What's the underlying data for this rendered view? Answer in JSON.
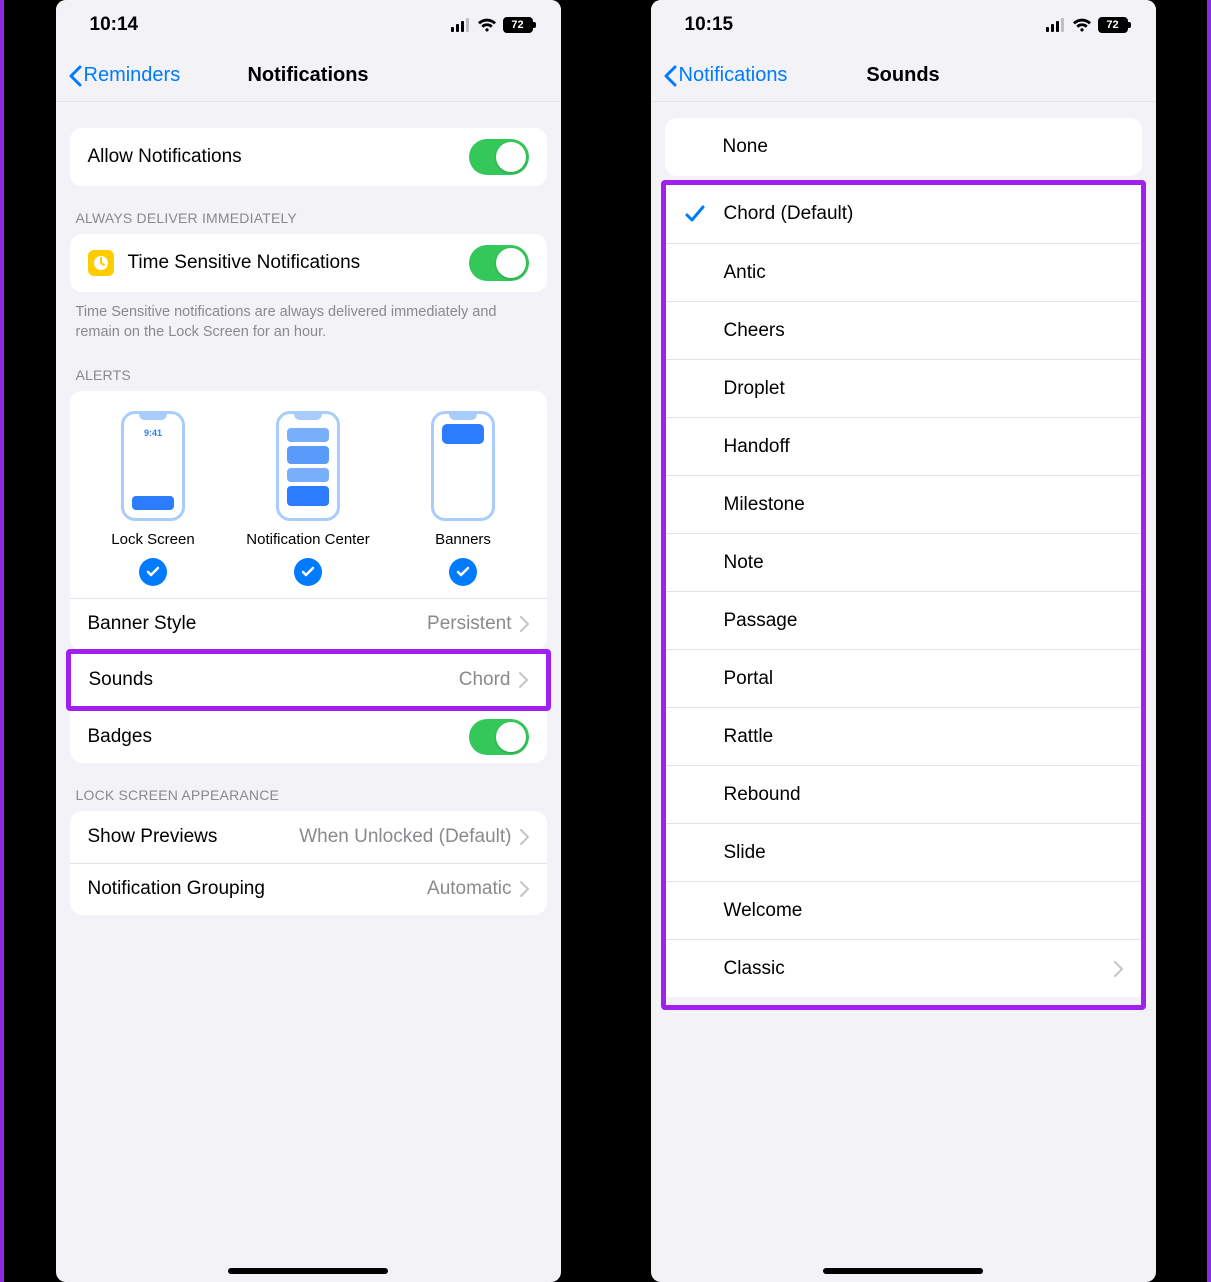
{
  "left": {
    "status": {
      "time": "10:14",
      "battery": "72"
    },
    "nav": {
      "back": "Reminders",
      "title": "Notifications"
    },
    "allow": {
      "label": "Allow Notifications"
    },
    "sec_always_header": "ALWAYS DELIVER IMMEDIATELY",
    "timesensitive": {
      "label": "Time Sensitive Notifications"
    },
    "ts_footer": "Time Sensitive notifications are always delivered immediately and remain on the Lock Screen for an hour.",
    "alerts_header": "ALERTS",
    "alerts": {
      "lock": "Lock Screen",
      "nc": "Notification Center",
      "banners": "Banners",
      "mini_time": "9:41"
    },
    "banner_style": {
      "label": "Banner Style",
      "value": "Persistent"
    },
    "sounds": {
      "label": "Sounds",
      "value": "Chord"
    },
    "badges": {
      "label": "Badges"
    },
    "lsa_header": "LOCK SCREEN APPEARANCE",
    "previews": {
      "label": "Show Previews",
      "value": "When Unlocked (Default)"
    },
    "grouping": {
      "label": "Notification Grouping",
      "value": "Automatic"
    }
  },
  "right": {
    "status": {
      "time": "10:15",
      "battery": "72"
    },
    "nav": {
      "back": "Notifications",
      "title": "Sounds"
    },
    "none": "None",
    "items": [
      "Chord (Default)",
      "Antic",
      "Cheers",
      "Droplet",
      "Handoff",
      "Milestone",
      "Note",
      "Passage",
      "Portal",
      "Rattle",
      "Rebound",
      "Slide",
      "Welcome",
      "Classic"
    ],
    "selected_index": 0
  }
}
